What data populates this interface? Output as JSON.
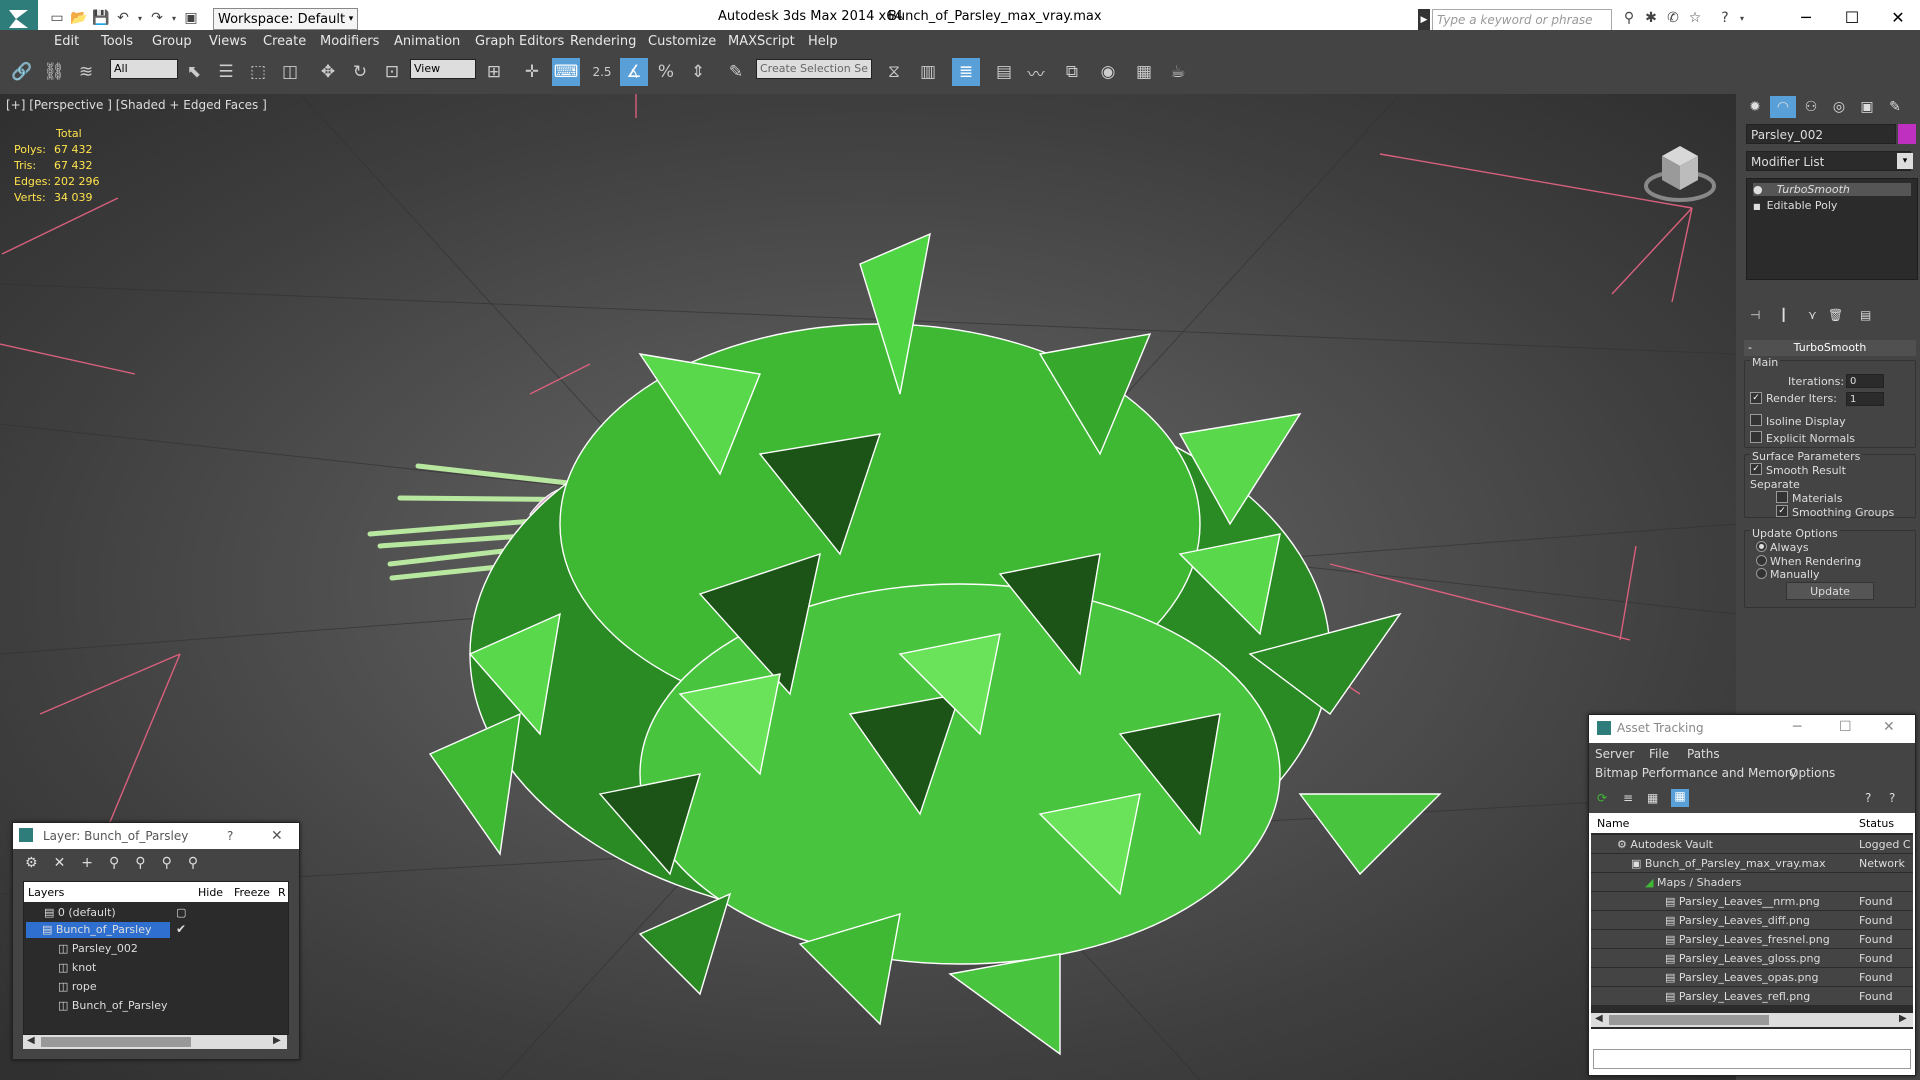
{
  "window": {
    "workspace": "Workspace: Default",
    "app_title": "Autodesk 3ds Max  2014 x64",
    "file_title": "Bunch_of_Parsley_max_vray.max",
    "search_placeholder": "Type a keyword or phrase"
  },
  "menu": [
    "Edit",
    "Tools",
    "Group",
    "Views",
    "Create",
    "Modifiers",
    "Animation",
    "Graph Editors",
    "Rendering",
    "Customize",
    "MAXScript",
    "Help"
  ],
  "toolbar": {
    "selection_filter": "All",
    "reference_coord": "View",
    "snap_value": "2.5",
    "named_selection": "Create Selection Se"
  },
  "viewport": {
    "label": "[+] [Perspective ] [Shaded + Edged Faces ]",
    "stats_header": "Total",
    "stats": [
      {
        "label": "Polys:",
        "value": "67 432"
      },
      {
        "label": "Tris:",
        "value": "67 432"
      },
      {
        "label": "Edges:",
        "value": "202 296"
      },
      {
        "label": "Verts:",
        "value": "34 039"
      }
    ]
  },
  "command_panel": {
    "object_name": "Parsley_002",
    "object_color": "#c030c0",
    "modifier_list": "Modifier List",
    "stack": [
      "TurboSmooth",
      "Editable Poly"
    ],
    "rollout_title": "TurboSmooth",
    "main_label": "Main",
    "iterations_label": "Iterations:",
    "iterations_value": "0",
    "render_iters_label": "Render Iters:",
    "render_iters_value": "1",
    "isoline_label": "Isoline Display",
    "explicit_normals_label": "Explicit Normals",
    "surface_params_label": "Surface Parameters",
    "smooth_result_label": "Smooth Result",
    "separate_label": "Separate",
    "materials_label": "Materials",
    "smoothing_groups_label": "Smoothing Groups",
    "update_options_label": "Update Options",
    "always_label": "Always",
    "when_rendering_label": "When Rendering",
    "manually_label": "Manually",
    "update_button": "Update"
  },
  "layer_window": {
    "title": "Layer: Bunch_of_Parsley",
    "help": "?",
    "columns": [
      "Layers",
      "Hide",
      "Freeze",
      "R"
    ],
    "rows": [
      "0 (default)",
      "Bunch_of_Parsley",
      "Parsley_002",
      "knot",
      "rope",
      "Bunch_of_Parsley"
    ]
  },
  "asset_window": {
    "title": "Asset Tracking",
    "menu1": [
      "Server",
      "File",
      "Paths"
    ],
    "menu2": [
      "Bitmap Performance and Memory",
      "Options"
    ],
    "columns": [
      "Name",
      "Status"
    ],
    "rows": [
      {
        "name": "Autodesk Vault",
        "status": "Logged C"
      },
      {
        "name": "Bunch_of_Parsley_max_vray.max",
        "status": "Network"
      },
      {
        "name": "Maps / Shaders",
        "status": ""
      },
      {
        "name": "Parsley_Leaves__nrm.png",
        "status": "Found"
      },
      {
        "name": "Parsley_Leaves_diff.png",
        "status": "Found"
      },
      {
        "name": "Parsley_Leaves_fresnel.png",
        "status": "Found"
      },
      {
        "name": "Parsley_Leaves_gloss.png",
        "status": "Found"
      },
      {
        "name": "Parsley_Leaves_opas.png",
        "status": "Found"
      },
      {
        "name": "Parsley_Leaves_refl.png",
        "status": "Found"
      }
    ]
  }
}
